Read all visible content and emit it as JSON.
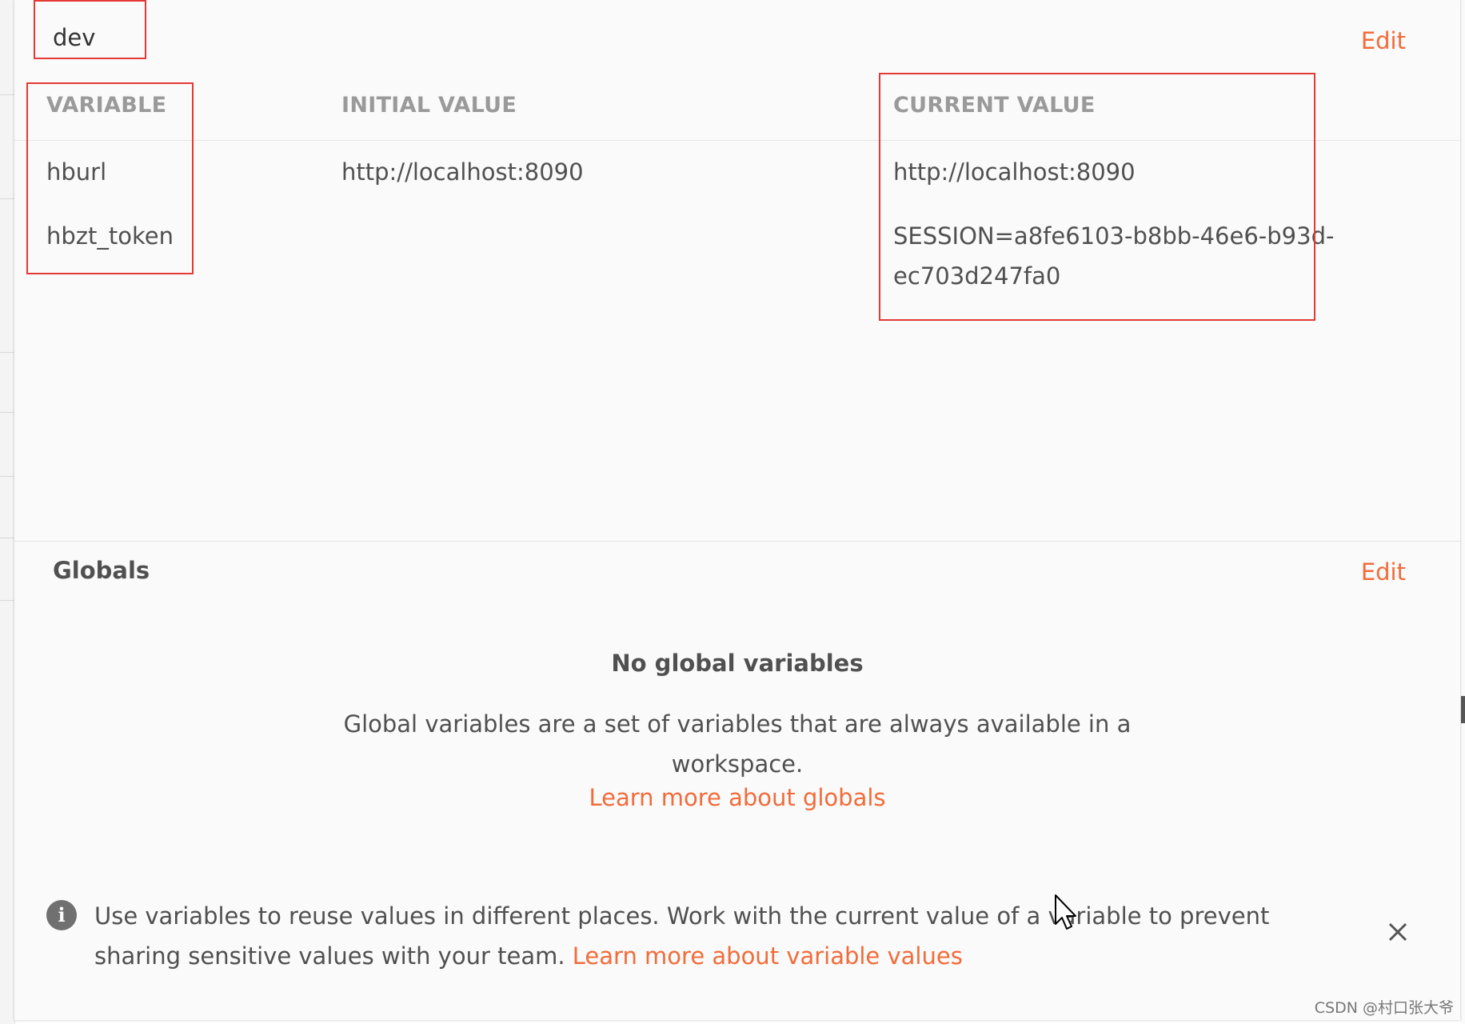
{
  "environment": {
    "name": "dev",
    "edit_label": "Edit",
    "columns": {
      "variable": "VARIABLE",
      "initial_value": "INITIAL VALUE",
      "current_value": "CURRENT VALUE"
    },
    "rows": [
      {
        "variable": "hburl",
        "initial_value": "http://localhost:8090",
        "current_value": "http://localhost:8090"
      },
      {
        "variable": "hbzt_token",
        "initial_value": "",
        "current_value_line1": "SESSION=a8fe6103-b8bb-46e6-b93d-",
        "current_value_line2": "ec703d247fa0"
      }
    ]
  },
  "globals": {
    "title": "Globals",
    "edit_label": "Edit",
    "empty_title": "No global variables",
    "empty_description": "Global variables are a set of variables that are always available in a workspace.",
    "learn_more": "Learn more about globals"
  },
  "info_banner": {
    "text": "Use variables to reuse values in different places. Work with the current value of a variable to prevent sharing sensitive values with your team.",
    "link": "Learn more about variable values"
  },
  "watermark": "CSDN @村口张大爷",
  "colors": {
    "accent": "#f26b3a",
    "annotation_red": "#e53935",
    "text": "#505050",
    "header_text": "#9a9a9a"
  },
  "icons": [
    "info-icon",
    "close-icon",
    "mouse-cursor-icon"
  ]
}
